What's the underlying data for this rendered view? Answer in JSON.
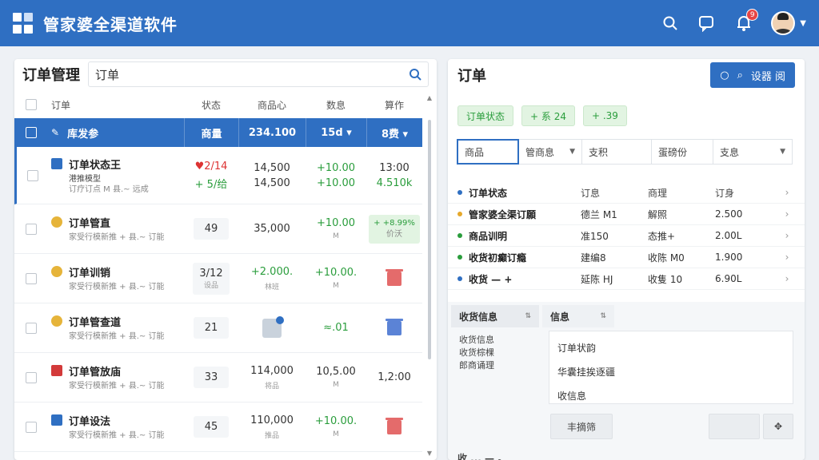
{
  "app": {
    "title": "管家婆全渠道软件",
    "notification_count": "9"
  },
  "left": {
    "title": "订单管理",
    "search_value": "订单",
    "columns": [
      "订单",
      "状态",
      "商品心",
      "数息",
      "算作"
    ],
    "selected_row": {
      "name": "库发参",
      "a": "商量",
      "b": "234.100",
      "c": "15d ▾",
      "d": "8费 ▾"
    },
    "rows": [
      {
        "title": "订单状态王",
        "sub1": "港推模型",
        "sub2": "订疗订点 M 县.~ 远成",
        "a1": "♥2/14",
        "a2": "+ 5/给",
        "b1": "14,500",
        "b2": "14,500",
        "c1": "+10.00",
        "c2": "+10.00",
        "d1": "13:00",
        "d2": "4.510k"
      },
      {
        "title": "订单管直",
        "sub1": "家受行模新推 + 县.~ 订能",
        "a1": "49",
        "b1": "35,000",
        "c1": "+10.00",
        "c2": "M",
        "d_box": "+ +8.99%",
        "d_box2": "价沃"
      },
      {
        "title": "订单训销",
        "sub1": "家受行模新推 + 县.~ 订能",
        "a1": "3/12",
        "a2": "设品",
        "b1": "+2.000.",
        "b2": "林班",
        "c1": "+10.00.",
        "c2": "M"
      },
      {
        "title": "订单管查道",
        "sub1": "家受行模新推 + 县.~ 订能",
        "a1": "21",
        "c1": "≈.01"
      },
      {
        "title": "订单管放庙",
        "sub1": "家受行模新推 + 县.~ 订能",
        "a1": "33",
        "b1": "114,000",
        "b2": "将品",
        "c1": "10,5.00",
        "c2": "M",
        "d1": "1,2:00"
      },
      {
        "title": "订单设法",
        "sub1": "家受行模新推 + 县.~ 订能",
        "a1": "45",
        "b1": "110,000",
        "b2": "推品",
        "c1": "+10.00.",
        "c2": "M"
      }
    ]
  },
  "right": {
    "title": "订单",
    "button_label": "设器 阅",
    "chips": [
      "订单状态",
      "+ 系 24",
      "+ .39"
    ],
    "filters": [
      "商品",
      "管商息",
      "支积",
      "蛋磅份",
      "支息"
    ],
    "table_header": [
      "订单状态",
      "订息",
      "商理",
      "订身"
    ],
    "table_rows": [
      {
        "c1": "管家婆全渠订願",
        "c2": "德兰 M1",
        "c3": "解照",
        "c4": "2.500",
        "color": "#e6a82a"
      },
      {
        "c1": "商品训明",
        "c2": "准150",
        "c3": "态推+",
        "c4": "2.00L",
        "color": "#2a9d3c"
      },
      {
        "c1": "收货初癫订瘾",
        "c2": "建编8",
        "c3": "收陈 M0",
        "c4": "1.900",
        "color": "#2a9d3c"
      },
      {
        "c1": "收货 — +",
        "c2": "延陈 HJ",
        "c3": "收隻 10",
        "c4": "6.90L",
        "color": "#2f6fc2"
      }
    ],
    "detail": {
      "tabs": [
        "收货信息",
        "信息"
      ],
      "left_lines": [
        "收货信息",
        "收货棕棵",
        "郎商诵理"
      ],
      "right_lines": [
        "订单状韵",
        "华囊挂挨逐疆",
        "收信息"
      ],
      "button1": "丰摘筛",
      "cutoff": "收 ... — 。"
    }
  }
}
